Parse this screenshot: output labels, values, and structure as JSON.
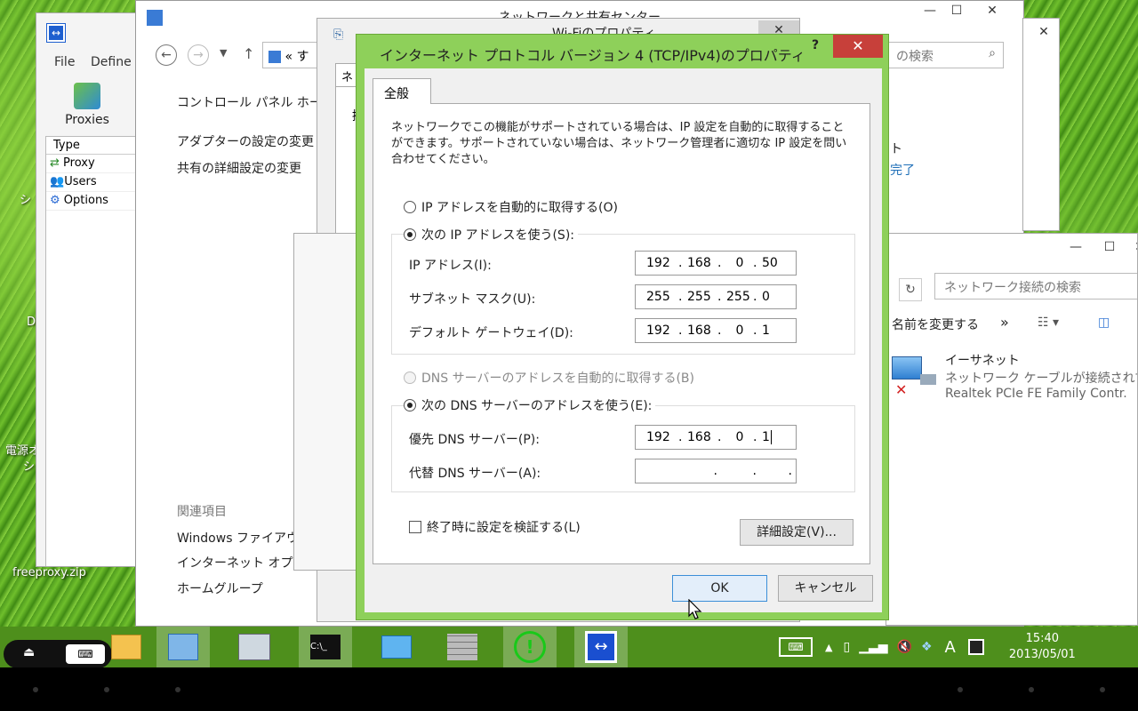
{
  "desktop": {
    "icon_labels": [
      "シ",
      "D",
      "電源オ",
      "シ",
      "freeproxy.zip"
    ]
  },
  "proxy_app": {
    "menu": [
      "File",
      "Define"
    ],
    "toolbar_label": "Proxies",
    "list_header": "Type",
    "items": [
      "Proxy",
      "Users",
      "Options"
    ]
  },
  "network_center": {
    "title": "ネットワークと共有センター",
    "breadcrumb_prefix": "«",
    "breadcrumb_rest": "す",
    "sidebar_home": "コントロール パネル ホーム",
    "sidebar_links": [
      "アダプターの設定の変更",
      "共有の詳細設定の変更"
    ],
    "related_heading": "関連項目",
    "related_links": [
      "Windows ファイアウォ",
      "インターネット オプション",
      "ホームグループ"
    ],
    "search_placeholder": "の検索",
    "right_texts": [
      "ト",
      "完了"
    ]
  },
  "wifi_props": {
    "title": "Wi-Fiのプロパティ",
    "tab_partial": "ネ",
    "row_partial": "接"
  },
  "net_connections": {
    "search_placeholder": "ネットワーク接続の検索",
    "toolbar_rename": "名前を変更する",
    "more": "»",
    "adapter_name": "イーサネット",
    "adapter_status": "ネットワーク ケーブルが接続されていま",
    "adapter_device": "Realtek PCIe FE Family Contr."
  },
  "dialog": {
    "title": "インターネット プロトコル バージョン 4 (TCP/IPv4)のプロパティ",
    "help_label": "?",
    "close_label": "✕",
    "tab": "全般",
    "description": "ネットワークでこの機能がサポートされている場合は、IP 設定を自動的に取得することができます。サポートされていない場合は、ネットワーク管理者に適切な IP 設定を問い合わせてください。",
    "ip_auto_label": "IP アドレスを自動的に取得する(O)",
    "ip_manual_label": "次の IP アドレスを使う(S):",
    "ip_address_label": "IP アドレス(I):",
    "ip_address": [
      "192",
      "168",
      "0",
      "50"
    ],
    "subnet_label": "サブネット マスク(U):",
    "subnet": [
      "255",
      "255",
      "255",
      "0"
    ],
    "gateway_label": "デフォルト ゲートウェイ(D):",
    "gateway": [
      "192",
      "168",
      "0",
      "1"
    ],
    "dns_auto_label": "DNS サーバーのアドレスを自動的に取得する(B)",
    "dns_manual_label": "次の DNS サーバーのアドレスを使う(E):",
    "dns_pref_label": "優先 DNS サーバー(P):",
    "dns_pref": [
      "192",
      "168",
      "0",
      "1"
    ],
    "dns_alt_label": "代替 DNS サーバー(A):",
    "dns_alt": [
      "",
      "",
      "",
      ""
    ],
    "validate_label": "終了時に設定を検証する(L)",
    "advanced_button": "詳細設定(V)...",
    "ok_button": "OK",
    "cancel_button": "キャンセル"
  },
  "taskbar": {
    "tray_ime": "A",
    "clock_time": "15:40",
    "clock_date": "2013/05/01"
  },
  "colors": {
    "dialog_frame": "#8ed05a",
    "close_button": "#c7403a",
    "taskbar": "#4e8f1c",
    "link": "#1e6fb8"
  }
}
